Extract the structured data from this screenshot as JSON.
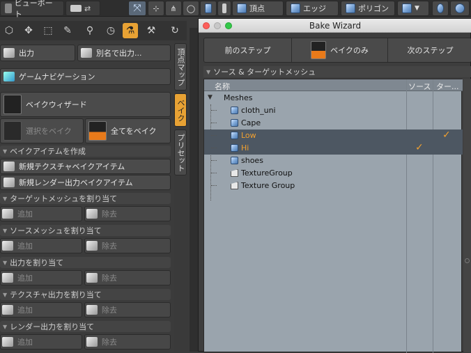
{
  "toolbar": {
    "viewport_label": "ビューポート",
    "vertex_label": "頂点",
    "edge_label": "エッジ",
    "polygon_label": "ポリゴン"
  },
  "left": {
    "output_label": "出力",
    "save_as_label": "別名で出力...",
    "game_nav_label": "ゲームナビゲーション",
    "bake_wizard_label": "ベイクウィザード",
    "bake_selected_label": "選択をベイク",
    "bake_all_label": "全てをベイク",
    "create_bake_items_header": "ベイクアイテムを作成",
    "new_texture_bake_label": "新規テクスチャベイクアイテム",
    "new_render_output_bake_label": "新規レンダー出力ベイクアイテム",
    "sections": [
      {
        "header": "ターゲットメッシュを割り当て",
        "add": "追加",
        "remove": "除去"
      },
      {
        "header": "ソースメッシュを割り当て",
        "add": "追加",
        "remove": "除去"
      },
      {
        "header": "出力を割り当て",
        "add": "追加",
        "remove": "除去"
      },
      {
        "header": "テクスチャ出力を割り当て",
        "add": "追加",
        "remove": "除去"
      },
      {
        "header": "レンダー出力を割り当て",
        "add": "追加",
        "remove": "除去"
      }
    ]
  },
  "vtabs": {
    "vertex_map": "頂点マップ",
    "bake": "ベイク",
    "preset": "プリセット"
  },
  "wizard": {
    "title": "Bake Wizard",
    "prev_step": "前のステップ",
    "bake_only": "ベイクのみ",
    "next_step": "次のステップ",
    "section_header": "ソース & ターゲットメッシュ",
    "columns": {
      "name": "名称",
      "source": "ソース",
      "target": "ター..."
    },
    "rows": [
      {
        "label": "Meshes",
        "type": "root",
        "source": "",
        "target": ""
      },
      {
        "label": "cloth_uni",
        "type": "mesh",
        "source": "",
        "target": ""
      },
      {
        "label": "Cape",
        "type": "mesh",
        "source": "",
        "target": ""
      },
      {
        "label": "Low",
        "type": "mesh",
        "selected": true,
        "source": "",
        "target": "✓"
      },
      {
        "label": "Hi",
        "type": "mesh",
        "selected": true,
        "source": "✓",
        "target": ""
      },
      {
        "label": "shoes",
        "type": "mesh",
        "source": "",
        "target": ""
      },
      {
        "label": "TextureGroup",
        "type": "group",
        "source": "",
        "target": ""
      },
      {
        "label": "Texture Group",
        "type": "group",
        "source": "",
        "target": ""
      }
    ]
  },
  "colors": {
    "accent": "#e8a234",
    "selection": "#4d5762",
    "tree_bg": "#9aa4ad"
  }
}
